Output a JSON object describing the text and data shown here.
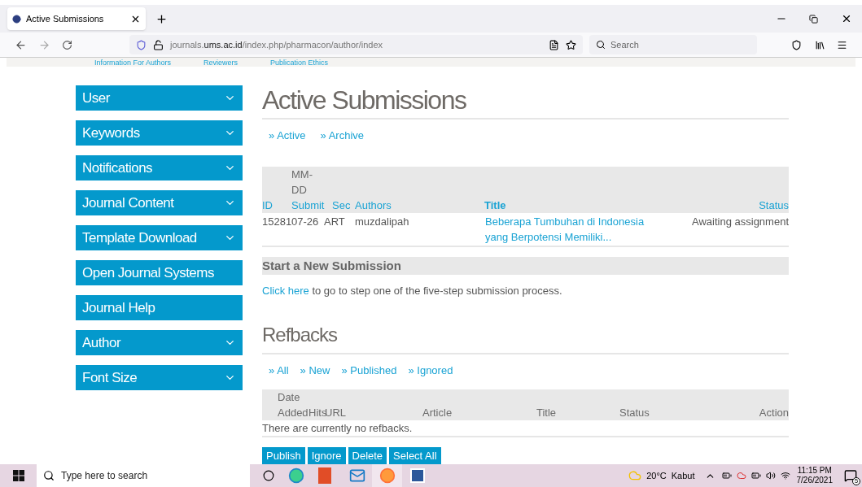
{
  "browser": {
    "tab_title": "Active Submissions",
    "url_prefix": "journals.",
    "url_domain": "ums.ac.id",
    "url_path": "/index.php/pharmacon/author/index",
    "search_placeholder": "Search"
  },
  "top_links": [
    "Information For Authors",
    "Reviewers",
    "Publication Ethics"
  ],
  "sidebar": {
    "items": [
      {
        "label": "User",
        "expandable": true
      },
      {
        "label": "Keywords",
        "expandable": true
      },
      {
        "label": "Notifications",
        "expandable": true
      },
      {
        "label": "Journal Content",
        "expandable": true
      },
      {
        "label": "Template Download",
        "expandable": true
      },
      {
        "label": "Open Journal Systems",
        "expandable": false
      },
      {
        "label": "Journal Help",
        "expandable": false
      },
      {
        "label": "Author",
        "expandable": true
      },
      {
        "label": "Font Size",
        "expandable": true
      }
    ]
  },
  "heading": "Active Submissions",
  "submission_tabs": [
    {
      "marker": "»",
      "label": "Active"
    },
    {
      "marker": "»",
      "label": "Archive"
    }
  ],
  "table": {
    "columns": [
      {
        "label": "ID",
        "bold": false
      },
      {
        "top": "MM-DD",
        "label": "Submit",
        "bold": false
      },
      {
        "label": "Sec",
        "bold": false
      },
      {
        "label": "Authors",
        "bold": false
      },
      {
        "label": "Title",
        "bold": true
      },
      {
        "label": "Status",
        "bold": false
      }
    ],
    "rows": [
      {
        "id": "15281",
        "date": "07-26",
        "sec": "ART",
        "authors": "muzdalipah",
        "title": "Beberapa Tumbuhan di Indonesia yang Berpotensi Memiliki...",
        "status": "Awaiting assignment"
      }
    ]
  },
  "new_submission": {
    "title": "Start a New Submission",
    "link": "Click here",
    "text": " to go to step one of the five-step submission process."
  },
  "refbacks": {
    "heading": "Refbacks",
    "filters": [
      {
        "marker": "»",
        "label": "All"
      },
      {
        "marker": "»",
        "label": "New"
      },
      {
        "marker": "»",
        "label": "Published"
      },
      {
        "marker": "»",
        "label": "Ignored"
      }
    ],
    "columns": [
      {
        "top": "Date",
        "label": "Added"
      },
      {
        "label": "Hits"
      },
      {
        "label": "URL"
      },
      {
        "label": "Article"
      },
      {
        "label": "Title"
      },
      {
        "label": "Status"
      },
      {
        "label": "Action"
      }
    ],
    "empty": "There are currently no refbacks.",
    "buttons": [
      "Publish",
      "Ignore",
      "Delete",
      "Select All"
    ]
  },
  "taskbar": {
    "search_placeholder": "Type here to search",
    "weather": "20°C",
    "weather_text": "Kabut",
    "time": "11:15 PM",
    "date": "7/26/2021",
    "notifications": "5"
  }
}
